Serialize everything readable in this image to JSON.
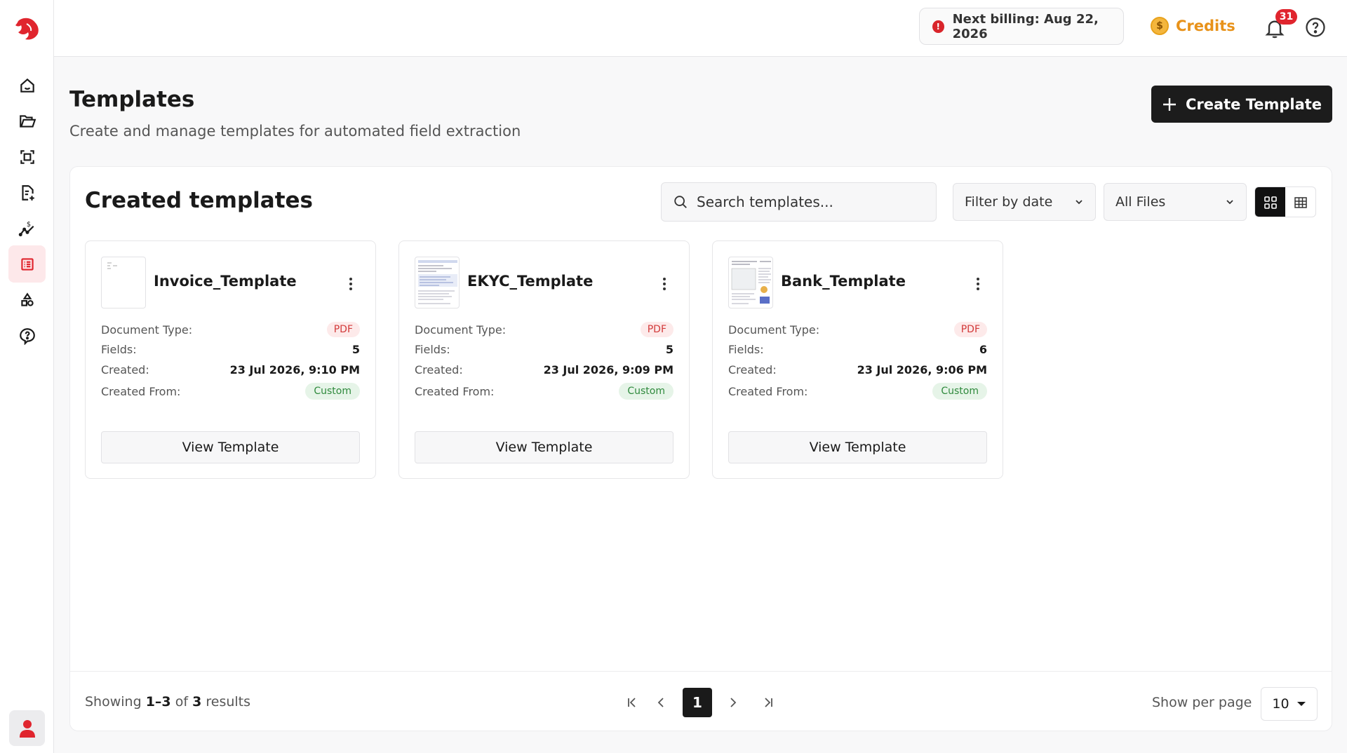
{
  "topbar": {
    "billing_text": "Next billing: Aug 22, 2026",
    "credits_label": "Credits",
    "notifications_count": "31"
  },
  "header": {
    "title": "Templates",
    "subtitle": "Create and manage templates for automated field extraction",
    "create_button": "Create Template"
  },
  "panel": {
    "title": "Created templates",
    "search_placeholder": "Search templates...",
    "filter_date": "Filter by date",
    "file_filter": "All Files"
  },
  "labels": {
    "document_type": "Document Type:",
    "fields": "Fields:",
    "created": "Created:",
    "created_from": "Created From:",
    "view_button": "View Template"
  },
  "cards": [
    {
      "name": "Invoice_Template",
      "doc_type": "PDF",
      "fields": "5",
      "created": "23 Jul 2026, 9:10 PM",
      "created_from": "Custom"
    },
    {
      "name": "EKYC_Template",
      "doc_type": "PDF",
      "fields": "5",
      "created": "23 Jul 2026, 9:09 PM",
      "created_from": "Custom"
    },
    {
      "name": "Bank_Template",
      "doc_type": "PDF",
      "fields": "6",
      "created": "23 Jul 2026, 9:06 PM",
      "created_from": "Custom"
    }
  ],
  "footer": {
    "showing_prefix": "Showing",
    "range": "1–3",
    "of": "of",
    "total": "3",
    "results": "results",
    "current_page": "1",
    "per_page_label": "Show per page",
    "per_page_value": "10"
  },
  "colors": {
    "brand": "#e0252e",
    "credits": "#e8921a",
    "primary_button": "#1c1c1c"
  },
  "icons": {
    "sidebar": [
      "home-icon",
      "folder-icon",
      "scan-icon",
      "document-add-icon",
      "cost-chart-icon",
      "templates-icon",
      "shapes-icon",
      "help-icon"
    ]
  }
}
